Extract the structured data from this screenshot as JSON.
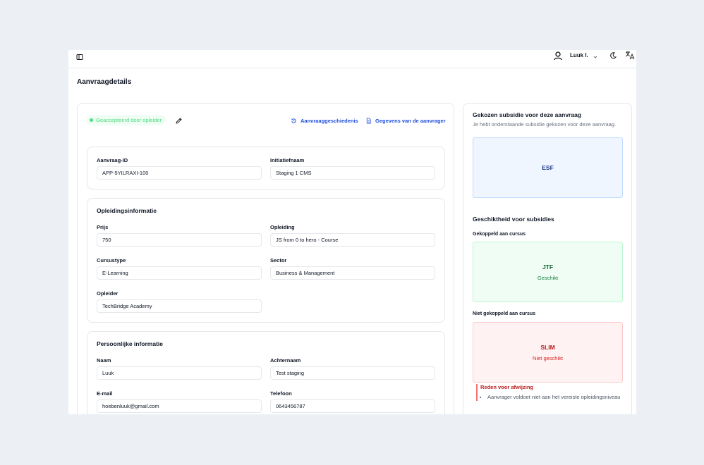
{
  "topbar": {
    "user_name": "Luuk I."
  },
  "page": {
    "title": "Aanvraagdetails"
  },
  "status": {
    "badge": "Geaccepteerd door opleider",
    "color": "#4ade80"
  },
  "links": {
    "history": "Aanvraaggeschiedenis",
    "applicant": "Gegevens van de aanvrager"
  },
  "ids": {
    "request_id_label": "Aanvraag-ID",
    "request_id_value": "APP-5YILRAXI-100",
    "initiative_label": "Initiatiefnaam",
    "initiative_value": "Staging 1 CMS"
  },
  "education": {
    "title": "Opleidingsinformatie",
    "price_label": "Prijs",
    "price_value": "750",
    "course_label": "Opleiding",
    "course_value": "JS from 0 to hero - Course",
    "course_type_label": "Cursustype",
    "course_type_value": "E-Learning",
    "sector_label": "Sector",
    "sector_value": "Business & Management",
    "provider_label": "Opleider",
    "provider_value": "TechBridge Academy"
  },
  "personal": {
    "title": "Persoonlijke informatie",
    "name_label": "Naam",
    "name_value": "Luuk",
    "surname_label": "Achternaam",
    "surname_value": "Test staging",
    "email_label": "E-mail",
    "email_value": "hoebenluuk@gmail.com",
    "phone_label": "Telefoon",
    "phone_value": "0643456787"
  },
  "subsidy": {
    "title": "Gekozen subsidie voor deze aanvraag",
    "subtitle": "Je hebt onderstaande subsidie gekozen voor deze aanvraag.",
    "chosen": "ESF",
    "eligibility_title": "Geschiktheid voor subsidies",
    "linked_label": "Gekoppeld aan cursus",
    "linked_name": "JTF",
    "linked_status": "Geschikt",
    "notlinked_label": "Niet gekoppeld aan cursus",
    "notlinked_name": "SLIM",
    "notlinked_status": "Niet geschikt",
    "reject_title": "Reden voor afwijzing",
    "reject_reason": "Aanvrager voldoet niet aan het vereiste opleidingsniveau"
  },
  "colors": {
    "accent": "#1d4ed8",
    "success": "#15803d",
    "danger": "#b91c1c"
  }
}
